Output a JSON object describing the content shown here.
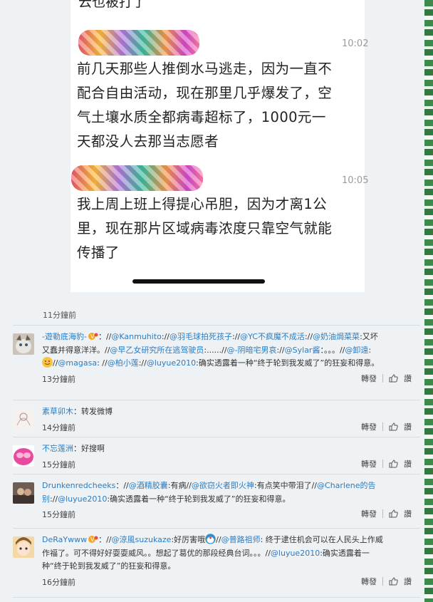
{
  "post": {
    "top_partial": "云也被打了",
    "m1": {
      "time": "10:02",
      "lines": [
        "前几天那些人推倒水马逃走，因为一直不",
        "配合自由活动，现在那里几乎爆发了，空",
        "气土壤水质全都病毒超标了，1000元一",
        "天都没人去那当志愿者"
      ]
    },
    "m2": {
      "time": "10:05",
      "lines": [
        "我上周上班上得提心吊胆，因为才离1公",
        "里，现在那片区域病毒浓度只靠空气就能",
        "传播了"
      ]
    },
    "post_time": "11分鐘前"
  },
  "actions": {
    "repost": "轉發",
    "like": "讚"
  },
  "comments": [
    {
      "user": "-遊勒底海豹-",
      "avatar": "cat-avatar",
      "lines": [
        [
          {
            "t": "：//"
          },
          {
            "l": "@Kanmuhito"
          },
          {
            "t": "://"
          },
          {
            "l": "@羽毛球拍死孩子"
          },
          {
            "t": "://"
          },
          {
            "l": "@YC不疯魔不成活"
          },
          {
            "t": "://"
          },
          {
            "l": "@奶油焗菜菜"
          },
          {
            "t": ":又坏"
          }
        ],
        [
          {
            "t": "又蠢并得意洋洋。//"
          },
          {
            "l": "@早乙女研究所在逃驾驶员"
          },
          {
            "t": ":......//"
          },
          {
            "l": "@-阴暗宅男哀"
          },
          {
            "t": "://"
          },
          {
            "l": "@Sylar酱"
          },
          {
            "t": "：。。。//"
          },
          {
            "l": "@卸遠"
          },
          {
            "t": ":"
          }
        ],
        [
          {
            "emoji": true
          },
          {
            "t": "//"
          },
          {
            "l": "@magasa"
          },
          {
            "t": ": //"
          },
          {
            "l": "@柏小莲"
          },
          {
            "t": "://"
          },
          {
            "l": "@luyue2010"
          },
          {
            "t": ":确实透露着一种“终于轮到我发威了”的狂妄和得意。"
          }
        ]
      ],
      "time": "13分鐘前"
    },
    {
      "user": "素草卯木",
      "avatar": "sketch-avatar",
      "lines": [
        [
          {
            "t": "：转发微博"
          }
        ]
      ],
      "time": "14分鐘前"
    },
    {
      "user": "不忘莲洲",
      "avatar": "pink-face-avatar",
      "lines": [
        [
          {
            "t": "：好搜啊"
          }
        ]
      ],
      "time": "15分鐘前"
    },
    {
      "user": "Drunkenredcheeks",
      "avatar": "photo-avatar",
      "lines": [
        [
          {
            "t": "：//"
          },
          {
            "l": "@酒精胶囊"
          },
          {
            "t": ":有病//"
          },
          {
            "l": "@欲窃火者即火神"
          },
          {
            "t": ":有点笑中带泪了//"
          },
          {
            "l": "@Charlene的告"
          }
        ],
        [
          {
            "l": "别"
          },
          {
            "t": "://"
          },
          {
            "l": "@luyue2010"
          },
          {
            "t": ":确实透露着一种“终于轮到我发威了”的狂妄和得意。"
          }
        ]
      ],
      "time": "15分鐘前"
    },
    {
      "user": "DeRaYwww",
      "avatar": "anime-avatar",
      "lines": [
        [
          {
            "t": "：//"
          },
          {
            "l": "@涼風suzukaze"
          },
          {
            "t": ":好厉害哦"
          },
          {
            "emoji2": true
          },
          {
            "t": "//"
          },
          {
            "l": "@普路祖师"
          },
          {
            "t": ": 终于逮住机会可以在人民头上作威"
          }
        ],
        [
          {
            "t": "作福了。可不得好好耍耍威风。。想起了葛优的那段经典台词。。。//"
          },
          {
            "l": "@luyue2010"
          },
          {
            "t": ":确实透露着一"
          }
        ],
        [
          {
            "t": "种“终于轮到我发威了”的狂妄和得意。"
          }
        ]
      ],
      "time": "16分鐘前"
    }
  ],
  "colors": {
    "link": "#2a7cc4",
    "stripe": "#3d8a4c",
    "background": "#eef2f4"
  }
}
